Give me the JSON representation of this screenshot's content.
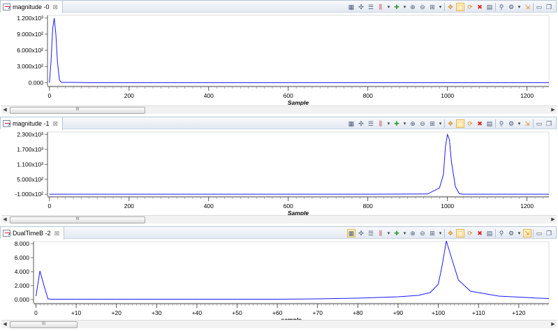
{
  "panels": [
    {
      "tab_label": "magnitude -0",
      "close_symbol": "⊠",
      "xlabel": "Sample",
      "ylim": [
        -60,
        1250
      ],
      "xlim": [
        -5,
        1255
      ],
      "yticks": [
        {
          "value": 1200,
          "label": "1.200x10³"
        },
        {
          "value": 900,
          "label": "9.000x10²"
        },
        {
          "value": 600,
          "label": "6.000x10²"
        },
        {
          "value": 300,
          "label": "3.000x10²"
        },
        {
          "value": 0,
          "label": "0.000"
        }
      ],
      "xticks": [
        {
          "value": 0,
          "label": "0"
        },
        {
          "value": 200,
          "label": "200"
        },
        {
          "value": 400,
          "label": "400"
        },
        {
          "value": 600,
          "label": "600"
        },
        {
          "value": 800,
          "label": "800"
        },
        {
          "value": 1000,
          "label": "1000"
        },
        {
          "value": 1200,
          "label": "1200"
        }
      ],
      "scroll_thumb": "III",
      "line_color": "#1a1aff"
    },
    {
      "tab_label": "magnitude -1",
      "close_symbol": "⊠",
      "xlabel": "Sample",
      "ylim": [
        -180,
        2400
      ],
      "xlim": [
        -5,
        1255
      ],
      "yticks": [
        {
          "value": 2300,
          "label": "2.300x10³"
        },
        {
          "value": 1700,
          "label": "1.700x10³"
        },
        {
          "value": 1100,
          "label": "1.100x10³"
        },
        {
          "value": 500,
          "label": "5.000x10²"
        },
        {
          "value": -100,
          "label": "-1.000x10²"
        }
      ],
      "xticks": [
        {
          "value": 0,
          "label": "0"
        },
        {
          "value": 200,
          "label": "200"
        },
        {
          "value": 400,
          "label": "400"
        },
        {
          "value": 600,
          "label": "600"
        },
        {
          "value": 800,
          "label": "800"
        },
        {
          "value": 1000,
          "label": "1000"
        },
        {
          "value": 1200,
          "label": "1200"
        }
      ],
      "scroll_thumb": "III",
      "line_color": "#1a1aff"
    },
    {
      "tab_label": "DualTimeB -2",
      "close_symbol": "⊠",
      "xlabel": "sample",
      "ylim": [
        -0.5,
        8.3
      ],
      "xlim": [
        -0.6,
        127.5
      ],
      "yticks": [
        {
          "value": 8,
          "label": "8.000"
        },
        {
          "value": 6,
          "label": "6.000"
        },
        {
          "value": 4,
          "label": "4.000"
        },
        {
          "value": 2,
          "label": "2.000"
        },
        {
          "value": 0,
          "label": "0.000"
        }
      ],
      "xticks": [
        {
          "value": 0,
          "label": "0"
        },
        {
          "value": 10,
          "label": "+10"
        },
        {
          "value": 20,
          "label": "+20"
        },
        {
          "value": 30,
          "label": "+30"
        },
        {
          "value": 40,
          "label": "+40"
        },
        {
          "value": 50,
          "label": "+50"
        },
        {
          "value": 60,
          "label": "+60"
        },
        {
          "value": 70,
          "label": "+70"
        },
        {
          "value": 80,
          "label": "+80"
        },
        {
          "value": 90,
          "label": "+90"
        },
        {
          "value": 100,
          "label": "+100"
        },
        {
          "value": 110,
          "label": "+110"
        },
        {
          "value": 120,
          "label": "+120"
        }
      ],
      "scroll_thumb": "III",
      "line_color": "#1a1aff"
    }
  ],
  "toolbar_icons": [
    "align-icon",
    "cursor-icon",
    "toggle-icon",
    "measure-icon",
    "dropdown-icon",
    "add-icon",
    "dropdown-icon",
    "zoom-in-icon",
    "zoom-out-icon",
    "zoom-fit-icon",
    "dropdown-icon",
    "separator",
    "pan-icon",
    "select-icon",
    "refresh-icon",
    "delete-icon",
    "table-icon",
    "separator",
    "binoculars-icon",
    "settings-icon",
    "dropdown-icon",
    "export-icon",
    "separator",
    "minimize-icon",
    "restore-icon"
  ],
  "chart_data": [
    {
      "type": "line",
      "title": "",
      "xlabel": "Sample",
      "ylabel": "",
      "x": [
        0,
        4,
        8,
        12,
        16,
        20,
        25,
        30,
        60,
        100,
        200,
        400,
        600,
        800,
        1000,
        1200,
        1255
      ],
      "series": [
        {
          "values": [
            0,
            400,
            1000,
            1200,
            900,
            400,
            50,
            5,
            5,
            0,
            0,
            0,
            0,
            0,
            0,
            0,
            0
          ]
        }
      ]
    },
    {
      "type": "line",
      "title": "",
      "xlabel": "Sample",
      "ylabel": "",
      "x": [
        0,
        200,
        400,
        600,
        800,
        950,
        980,
        990,
        995,
        1000,
        1005,
        1010,
        1020,
        1030,
        1040,
        1100,
        1200,
        1255
      ],
      "series": [
        {
          "values": [
            -100,
            -100,
            -100,
            -100,
            -100,
            -90,
            150,
            700,
            1800,
            2300,
            2100,
            1200,
            200,
            -80,
            -100,
            -100,
            -100,
            -100
          ]
        }
      ]
    },
    {
      "type": "line",
      "title": "",
      "xlabel": "sample",
      "ylabel": "",
      "x": [
        0,
        1,
        2,
        3,
        4,
        10,
        30,
        60,
        70,
        80,
        90,
        95,
        98,
        100,
        101,
        102,
        103,
        105,
        108,
        115,
        125,
        127.5
      ],
      "series": [
        {
          "values": [
            0.5,
            4.1,
            2.0,
            0.1,
            0.05,
            0.05,
            0.05,
            0.05,
            0.1,
            0.2,
            0.4,
            0.6,
            1.0,
            2.2,
            5.0,
            8.4,
            6.5,
            2.8,
            1.2,
            0.5,
            0.2,
            0.15
          ]
        }
      ]
    }
  ]
}
